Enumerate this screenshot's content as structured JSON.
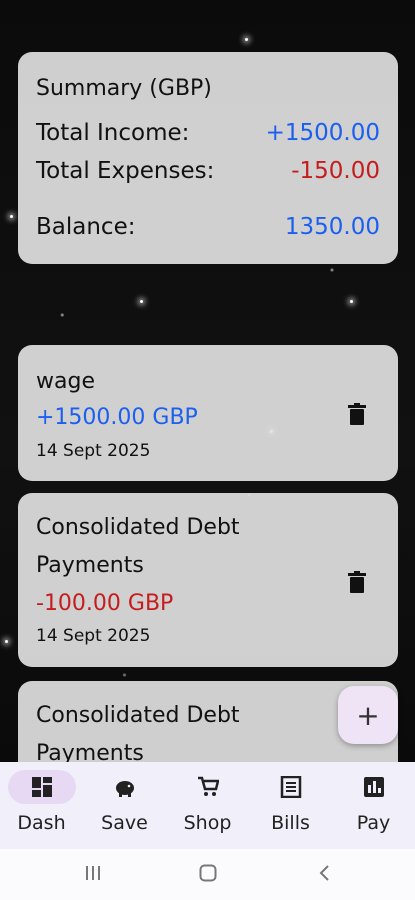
{
  "summary": {
    "title": "Summary (GBP)",
    "income_label": "Total Income:",
    "income_value": "+1500.00",
    "expenses_label": "Total Expenses:",
    "expenses_value": "-150.00",
    "balance_label": "Balance:",
    "balance_value": "1350.00"
  },
  "transactions": [
    {
      "name": "wage",
      "amount": "+1500.00 GBP",
      "date": "14 Sept 2025",
      "type": "income"
    },
    {
      "name_line1": "Consolidated Debt",
      "name_line2": "Payments",
      "amount": "-100.00 GBP",
      "date": "14 Sept 2025",
      "type": "expense"
    },
    {
      "name_line1": "Consolidated Debt",
      "name_line2": "Payments"
    }
  ],
  "fab": {
    "label": "+"
  },
  "nav": {
    "items": [
      {
        "label": "Dash",
        "icon": "dashboard-icon"
      },
      {
        "label": "Save",
        "icon": "piggy-bank-icon"
      },
      {
        "label": "Shop",
        "icon": "shopping-cart-icon"
      },
      {
        "label": "Bills",
        "icon": "receipt-icon"
      },
      {
        "label": "Pay",
        "icon": "chart-icon"
      }
    ]
  },
  "colors": {
    "income": "#1a5ff0",
    "expense": "#c51d1d",
    "nav_active": "#e7d9f3"
  }
}
